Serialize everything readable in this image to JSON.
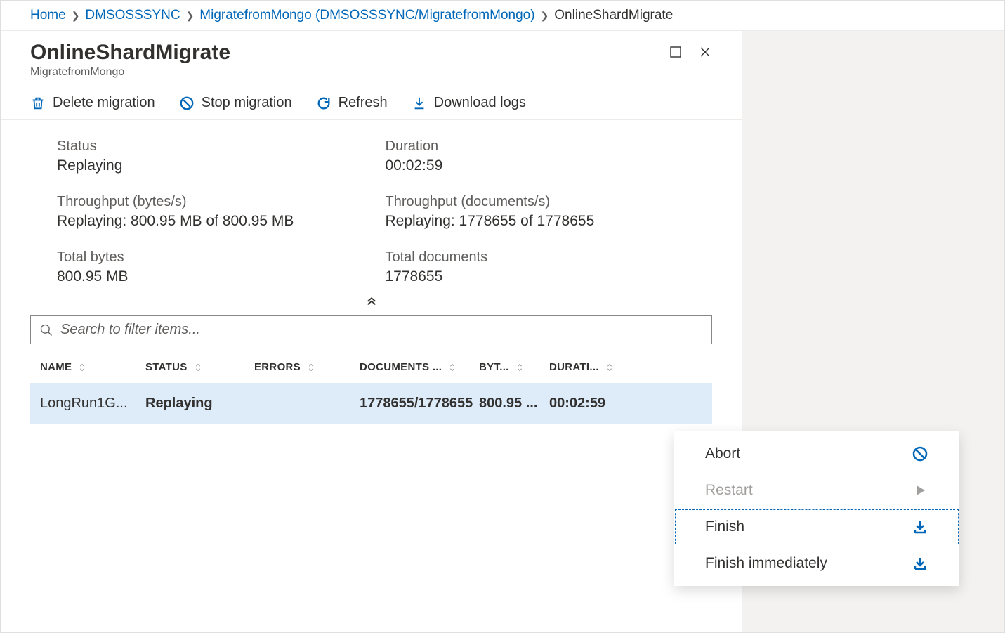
{
  "breadcrumb": {
    "items": [
      {
        "label": "Home"
      },
      {
        "label": "DMSOSSSYNC"
      },
      {
        "label": "MigratefromMongo (DMSOSSSYNC/MigratefromMongo)"
      }
    ],
    "current": "OnlineShardMigrate"
  },
  "header": {
    "title": "OnlineShardMigrate",
    "subtitle": "MigratefromMongo"
  },
  "toolbar": {
    "delete": "Delete migration",
    "stop": "Stop migration",
    "refresh": "Refresh",
    "download": "Download logs"
  },
  "details": {
    "status_label": "Status",
    "status_value": "Replaying",
    "duration_label": "Duration",
    "duration_value": "00:02:59",
    "throughput_bytes_label": "Throughput (bytes/s)",
    "throughput_bytes_value": "Replaying: 800.95 MB of 800.95 MB",
    "throughput_docs_label": "Throughput (documents/s)",
    "throughput_docs_value": "Replaying: 1778655 of 1778655",
    "total_bytes_label": "Total bytes",
    "total_bytes_value": "800.95 MB",
    "total_docs_label": "Total documents",
    "total_docs_value": "1778655"
  },
  "search": {
    "placeholder": "Search to filter items..."
  },
  "table": {
    "columns": {
      "name": "NAME",
      "status": "STATUS",
      "errors": "ERRORS",
      "documents": "DOCUMENTS ...",
      "bytes": "BYT...",
      "duration": "DURATI..."
    },
    "rows": [
      {
        "name": "LongRun1G...",
        "status": "Replaying",
        "errors": "",
        "documents": "1778655/1778655",
        "bytes": "800.95 ...",
        "duration": "00:02:59"
      }
    ]
  },
  "context_menu": {
    "abort": "Abort",
    "restart": "Restart",
    "finish": "Finish",
    "finish_immediately": "Finish immediately"
  }
}
